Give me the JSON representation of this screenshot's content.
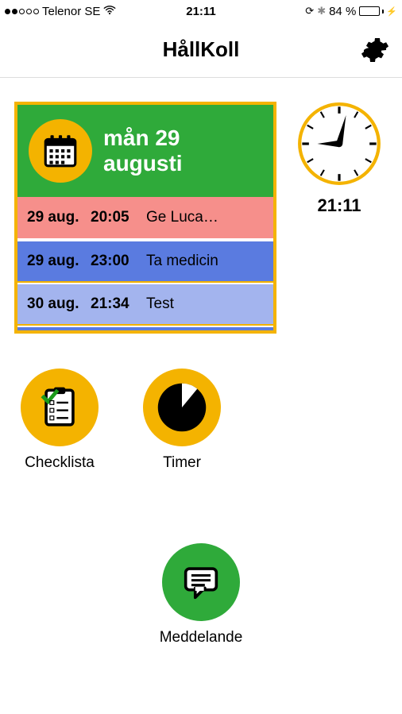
{
  "status": {
    "carrier": "Telenor SE",
    "time": "21:11",
    "battery_pct": "84 %"
  },
  "nav": {
    "title": "HållKoll"
  },
  "calendar": {
    "date_line1": "mån 29",
    "date_line2": "augusti",
    "events": [
      {
        "date": "29 aug.",
        "time": "20:05",
        "label": "Ge Luca…"
      },
      {
        "date": "29 aug.",
        "time": "23:00",
        "label": "Ta medicin"
      },
      {
        "date": "30 aug.",
        "time": "21:34",
        "label": "Test"
      }
    ]
  },
  "clock": {
    "time": "21:11"
  },
  "launchers": {
    "checklist": "Checklista",
    "timer": "Timer",
    "message": "Meddelande"
  }
}
